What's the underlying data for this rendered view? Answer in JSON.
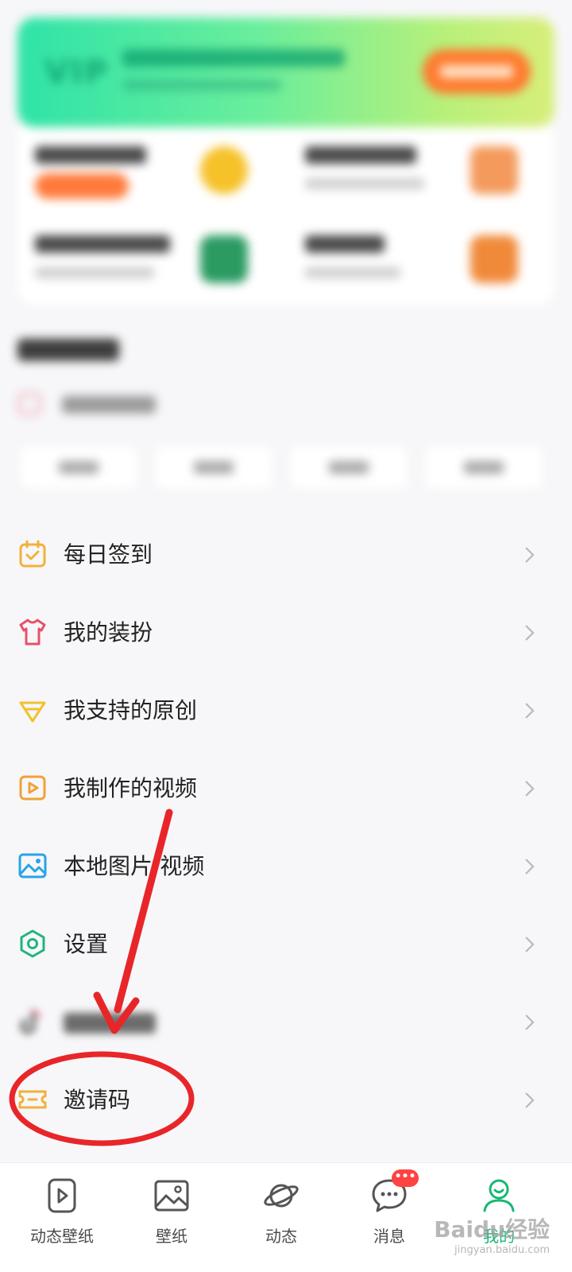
{
  "menu": {
    "items": [
      {
        "label": "每日签到",
        "icon": "calendar-check-icon",
        "color": "#f2b13a"
      },
      {
        "label": "我的装扮",
        "icon": "tshirt-icon",
        "color": "#e8506a"
      },
      {
        "label": "我支持的原创",
        "icon": "diamond-icon",
        "color": "#f2c12e"
      },
      {
        "label": "我制作的视频",
        "icon": "video-play-icon",
        "color": "#f0a236"
      },
      {
        "label": "本地图片/视频",
        "icon": "image-icon",
        "color": "#2aa3e8"
      },
      {
        "label": "设置",
        "icon": "hexagon-gear-icon",
        "color": "#20b57a"
      },
      {
        "label": "",
        "icon": "tiktok-icon",
        "color": "#333333"
      },
      {
        "label": "邀请码",
        "icon": "ticket-icon",
        "color": "#f2b13a"
      }
    ]
  },
  "bottom_nav": {
    "items": [
      {
        "label": "动态壁纸",
        "icon": "live-wallpaper-icon"
      },
      {
        "label": "壁纸",
        "icon": "wallpaper-icon"
      },
      {
        "label": "动态",
        "icon": "planet-icon"
      },
      {
        "label": "消息",
        "icon": "message-bubble-icon",
        "badge": "•••"
      },
      {
        "label": "我的",
        "icon": "profile-icon",
        "active": true
      }
    ]
  },
  "colors": {
    "accent_green": "#18b873",
    "annotation_red": "#e8262a",
    "vip_gradient_start": "#2fe3a8",
    "vip_button": "#ff7a2e"
  },
  "watermark": {
    "main": "Baidu经验",
    "sub": "jingyan.baidu.com"
  }
}
